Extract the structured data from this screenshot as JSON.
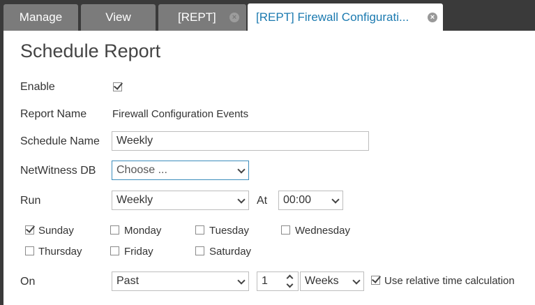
{
  "tabs": [
    {
      "label": "Manage",
      "active": false
    },
    {
      "label": "View",
      "active": false
    },
    {
      "label": "[REPT]",
      "active": false,
      "closable": true
    },
    {
      "label": "[REPT] Firewall Configurati...",
      "active": true,
      "closable": true
    }
  ],
  "form": {
    "title": "Schedule Report",
    "enable_label": "Enable",
    "enable_checked": true,
    "report_name_label": "Report Name",
    "report_name_value": "Firewall Configuration Events",
    "schedule_name_label": "Schedule Name",
    "schedule_name_value": "Weekly",
    "db_label": "NetWitness DB",
    "db_placeholder": "Choose ...",
    "run_label": "Run",
    "run_value": "Weekly",
    "at_label": "At",
    "at_value": "00:00",
    "days": [
      {
        "label": "Sunday",
        "checked": true
      },
      {
        "label": "Monday",
        "checked": false
      },
      {
        "label": "Tuesday",
        "checked": false
      },
      {
        "label": "Wednesday",
        "checked": false
      },
      {
        "label": "Thursday",
        "checked": false
      },
      {
        "label": "Friday",
        "checked": false
      },
      {
        "label": "Saturday",
        "checked": false
      }
    ],
    "on_label": "On",
    "on_value": "Past",
    "on_count": "1",
    "on_unit": "Weeks",
    "relative_label": "Use relative time calculation",
    "relative_checked": true
  }
}
